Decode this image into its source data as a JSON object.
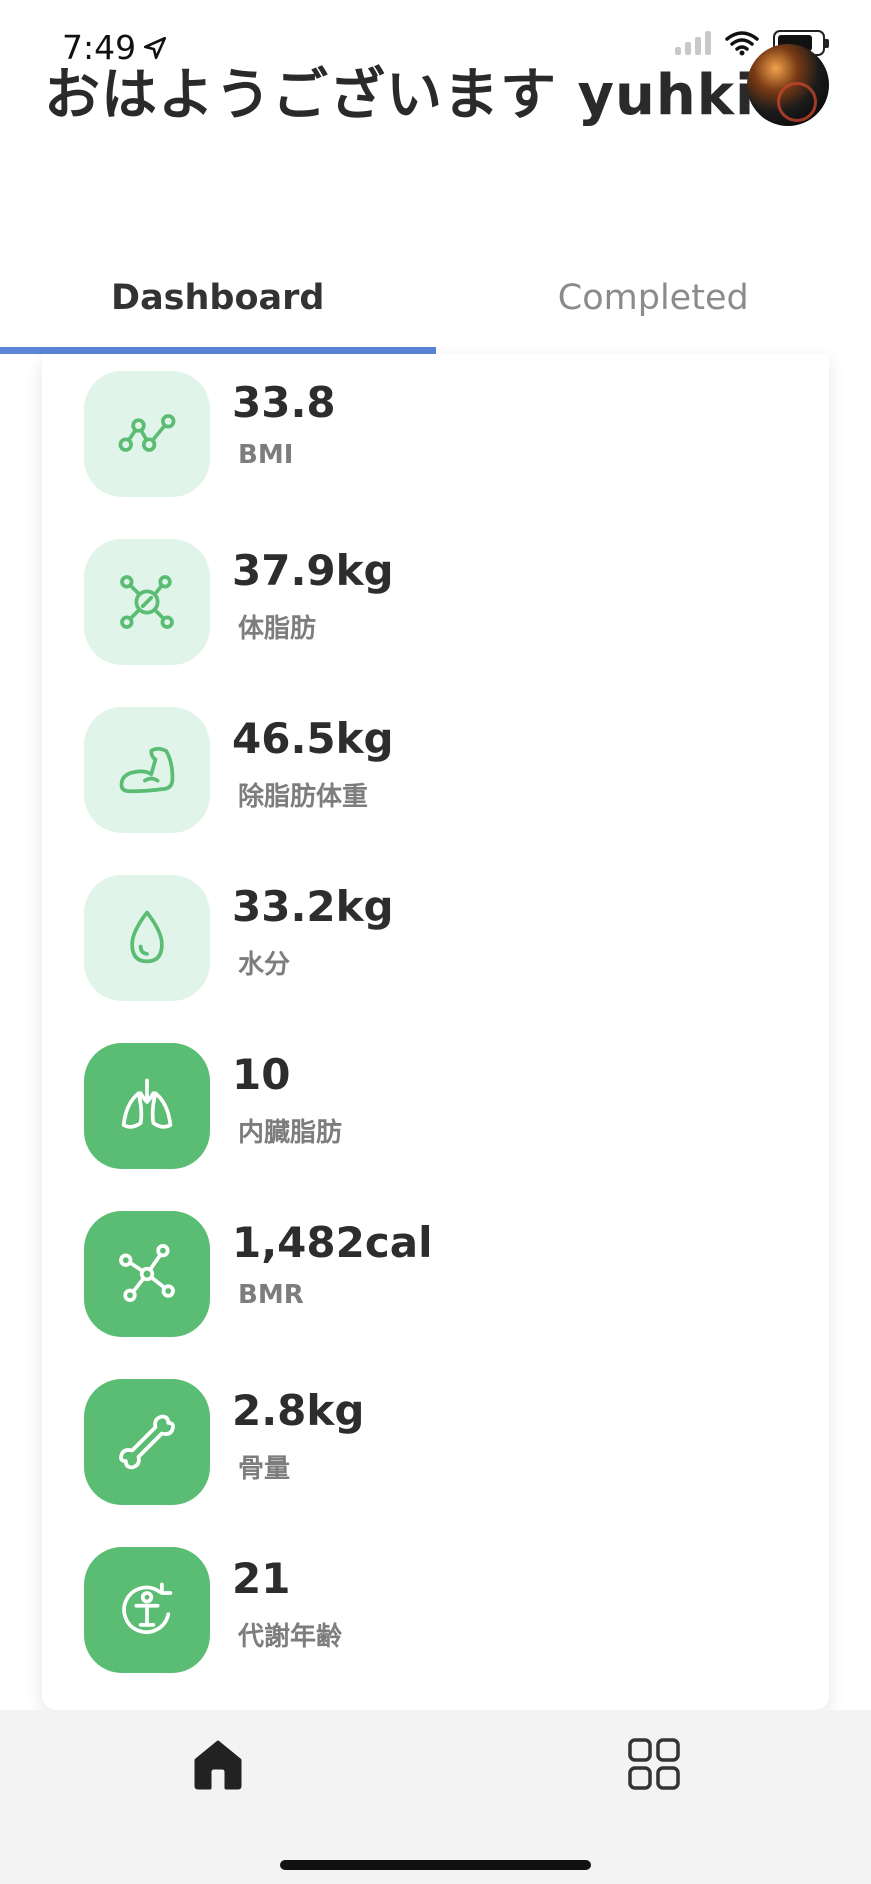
{
  "status_bar": {
    "time": "7:49"
  },
  "header": {
    "greeting": "おはようございます yuhki"
  },
  "tabs": [
    {
      "label": "Dashboard",
      "active": true
    },
    {
      "label": "Completed",
      "active": false
    }
  ],
  "metrics": [
    {
      "value": "33.8",
      "label": "BMI",
      "icon": "line-chart-icon",
      "style": "light"
    },
    {
      "value": "37.9kg",
      "label": "体脂肪",
      "icon": "molecule-icon",
      "style": "light"
    },
    {
      "value": "46.5kg",
      "label": "除脂肪体重",
      "icon": "muscle-arm-icon",
      "style": "light"
    },
    {
      "value": "33.2kg",
      "label": "水分",
      "icon": "water-drop-icon",
      "style": "light"
    },
    {
      "value": "10",
      "label": "内臓脂肪",
      "icon": "lungs-icon",
      "style": "solid"
    },
    {
      "value": "1,482cal",
      "label": "BMR",
      "icon": "network-icon",
      "style": "solid"
    },
    {
      "value": "2.8kg",
      "label": "骨量",
      "icon": "bone-icon",
      "style": "solid"
    },
    {
      "value": "21",
      "label": "代謝年齢",
      "icon": "metabolic-age-icon",
      "style": "solid"
    }
  ],
  "colors": {
    "accent_green": "#5bbd73",
    "light_green": "#e1f4ea",
    "tab_indicator": "#5b84d6"
  },
  "bottom_nav": [
    {
      "icon": "home-icon",
      "active": true
    },
    {
      "icon": "grid-icon",
      "active": false
    }
  ]
}
